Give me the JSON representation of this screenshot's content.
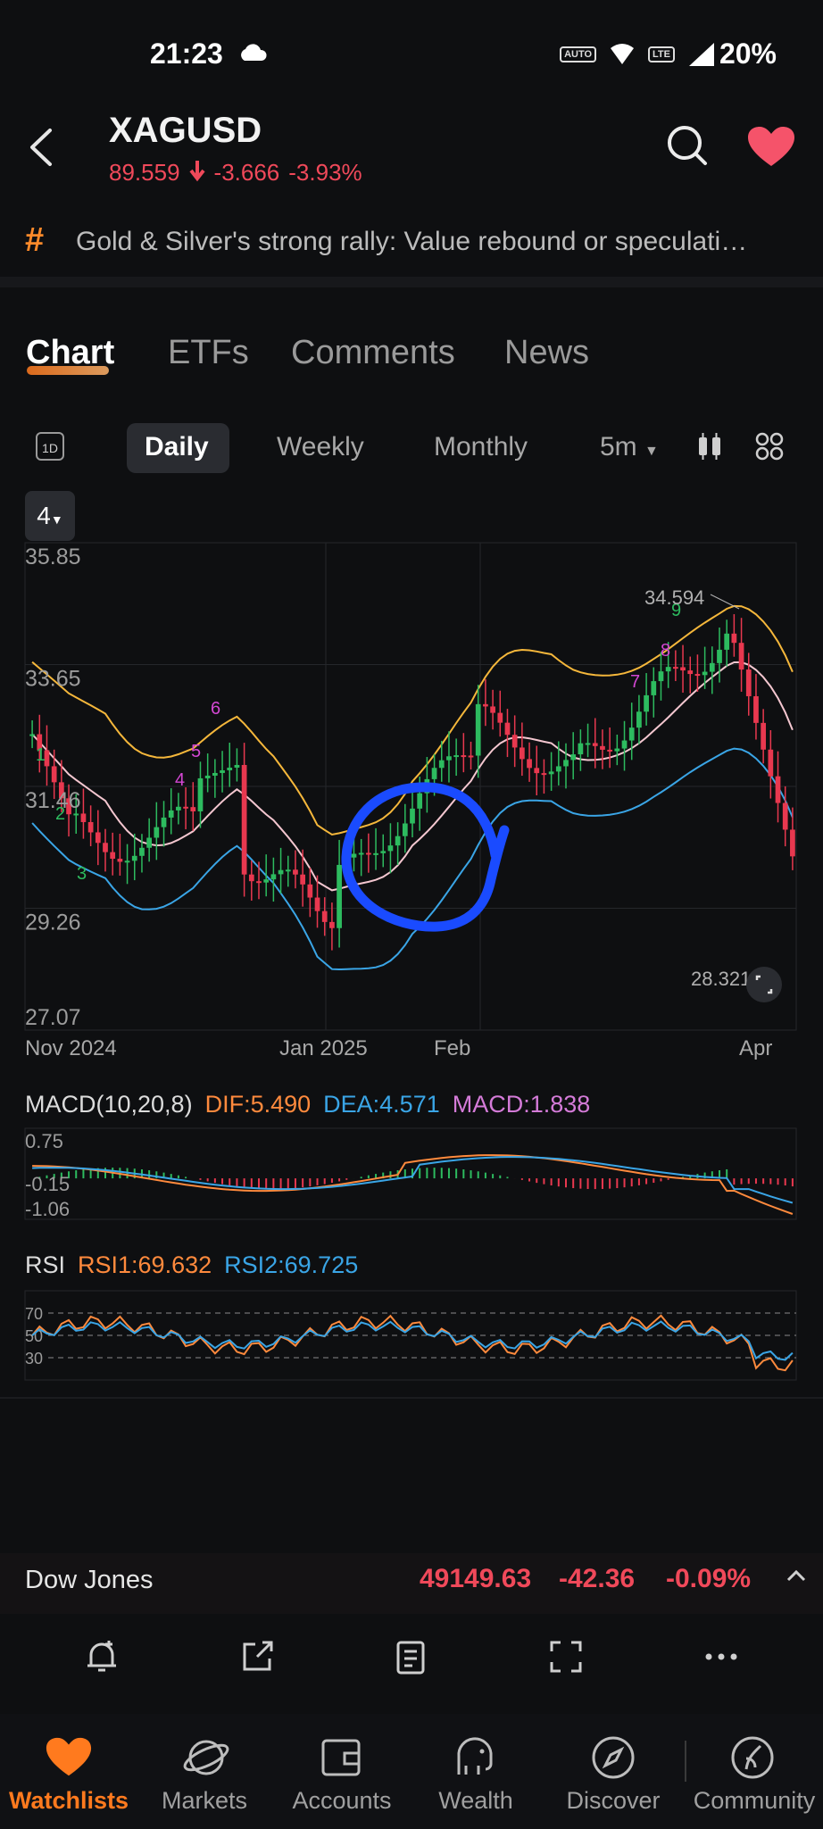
{
  "status": {
    "time": "21:23",
    "auto_badge": "AUTO",
    "lte_badge": "LTE",
    "battery": "20%"
  },
  "header": {
    "ticker": "XAGUSD",
    "price": "89.559",
    "change": "-3.666",
    "change_pct": "-3.93%"
  },
  "news": {
    "text": "Gold & Silver's strong rally: Value rebound or speculati…"
  },
  "tabs": [
    {
      "label": "Chart"
    },
    {
      "label": "ETFs"
    },
    {
      "label": "Comments"
    },
    {
      "label": "News"
    }
  ],
  "periods": {
    "day_icon": "1D",
    "daily": "Daily",
    "weekly": "Weekly",
    "monthly": "Monthly",
    "interval": "5m"
  },
  "series_select": "4",
  "colors": {
    "up": "#2dbb5f",
    "down": "#e8384f",
    "upper_band": "#f5b73b",
    "mid_band": "#f4c7d0",
    "lower_band": "#3aa5e6",
    "accent": "#ff7a1e"
  },
  "chart_data": {
    "type": "candlestick",
    "y_ticks": [
      "35.85",
      "33.65",
      "31.46",
      "29.26",
      "27.07"
    ],
    "x_ticks": [
      "Nov 2024",
      "Jan 2025",
      "Feb",
      "Apr"
    ],
    "ylim": [
      27.07,
      35.85
    ],
    "high_label": "34.594",
    "low_label": "28.321",
    "annotations": [
      "1",
      "2",
      "3",
      "4",
      "5",
      "6",
      "7",
      "8",
      "9"
    ],
    "macd": {
      "title": "MACD(10,20,8)",
      "dif": "DIF:5.490",
      "dea": "DEA:4.571",
      "macd": "MACD:1.838",
      "ticks": [
        "0.75",
        "-0.15",
        "-1.06"
      ]
    },
    "rsi": {
      "title": "RSI",
      "rsi1": "RSI1:69.632",
      "rsi2": "RSI2:69.725",
      "levels": [
        "70",
        "50",
        "30"
      ]
    }
  },
  "index_bar": {
    "name": "Dow Jones",
    "price": "49149.63",
    "change": "-42.36",
    "pct": "-0.09%"
  },
  "nav": [
    {
      "label": "Watchlists"
    },
    {
      "label": "Markets"
    },
    {
      "label": "Accounts"
    },
    {
      "label": "Wealth"
    },
    {
      "label": "Discover"
    },
    {
      "label": "Community"
    }
  ]
}
